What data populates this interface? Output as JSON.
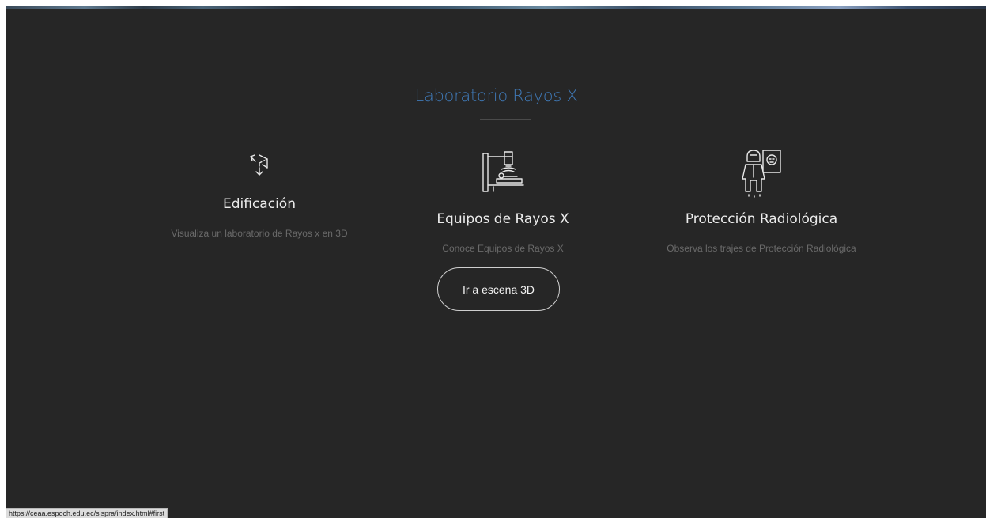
{
  "section": {
    "title": "Laboratorio Rayos X"
  },
  "cards": [
    {
      "title": "Edificación",
      "description": "Visualiza un laboratorio de Rayos x en 3D",
      "icon": "cube-expand-icon"
    },
    {
      "title": "Equipos de Rayos X",
      "description": "Conoce Equipos de Rayos X",
      "icon": "xray-machine-icon"
    },
    {
      "title": "Protección Radiológica",
      "description": "Observa los trajes de Protección Radiológica",
      "icon": "radiation-protection-suit-icon"
    }
  ],
  "cta": {
    "label": "Ir a escena 3D"
  },
  "status_bar": {
    "url": "https://ceaa.espoch.edu.ec/sispra/index.html#first"
  },
  "colors": {
    "background": "#262626",
    "title_accent": "#3f78b5",
    "card_title": "#ececec",
    "card_description": "#6a6a6a"
  }
}
